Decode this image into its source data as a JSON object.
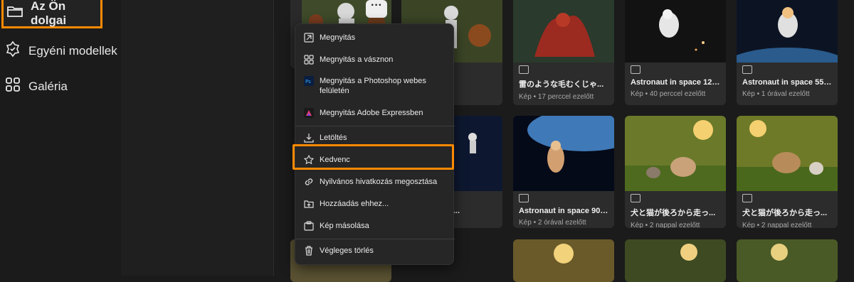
{
  "sidebar": {
    "items": [
      {
        "label": "Az Ön dolgai",
        "icon": "folder-icon",
        "active": true
      },
      {
        "label": "Egyéni modellek",
        "icon": "custom-models-icon"
      },
      {
        "label": "Galéria",
        "icon": "gallery-grid-icon"
      }
    ]
  },
  "menu": {
    "items": [
      {
        "label": "Megnyitás",
        "icon": "open-arrow-icon"
      },
      {
        "label": "Megnyitás a vásznon",
        "icon": "canvas-icon"
      },
      {
        "label": "Megnyitás a Photoshop webes felületén",
        "icon": "photoshop-icon"
      },
      {
        "label": "Megnyitás Adobe Expressben",
        "icon": "adobe-express-icon"
      },
      {
        "label": "Letöltés",
        "icon": "download-icon"
      },
      {
        "label": "Kedvenc",
        "icon": "star-icon"
      },
      {
        "label": "Nyilvános hivatkozás megosztása",
        "icon": "link-icon"
      },
      {
        "label": "Hozzáadás ehhez...",
        "icon": "add-to-folder-icon"
      },
      {
        "label": "Kép másolása",
        "icon": "copy-image-icon"
      },
      {
        "label": "Végleges törlés",
        "icon": "trash-icon"
      }
    ]
  },
  "more_button": {
    "label": "···"
  },
  "cards": {
    "row1": [
      {
        "title": "d in betwe...",
        "meta": "ezelőtt"
      },
      {
        "title": "雷のような毛むくじゃ...",
        "meta": "Kép • 17 perccel ezelőtt"
      },
      {
        "title": "Astronaut in space 122411...",
        "meta": "Kép • 40 perccel ezelőtt"
      },
      {
        "title": "Astronaut in space 553771...",
        "meta": "Kép • 1 órával ezelőtt"
      }
    ],
    "row2": [
      {
        "title": "space 37388...",
        "meta": "ezelőtt"
      },
      {
        "title": "Astronaut in space 90522...",
        "meta": "Kép • 2 órával ezelőtt"
      },
      {
        "title": "犬と猫が後ろから走っ...",
        "meta": "Kép • 2 nappal ezelőtt"
      },
      {
        "title": "犬と猫が後ろから走っ...",
        "meta": "Kép • 2 nappal ezelőtt"
      }
    ]
  },
  "colors": {
    "accent": "#ff8a00",
    "menu_bg": "#262626",
    "card_bg": "#2c2c2c"
  }
}
